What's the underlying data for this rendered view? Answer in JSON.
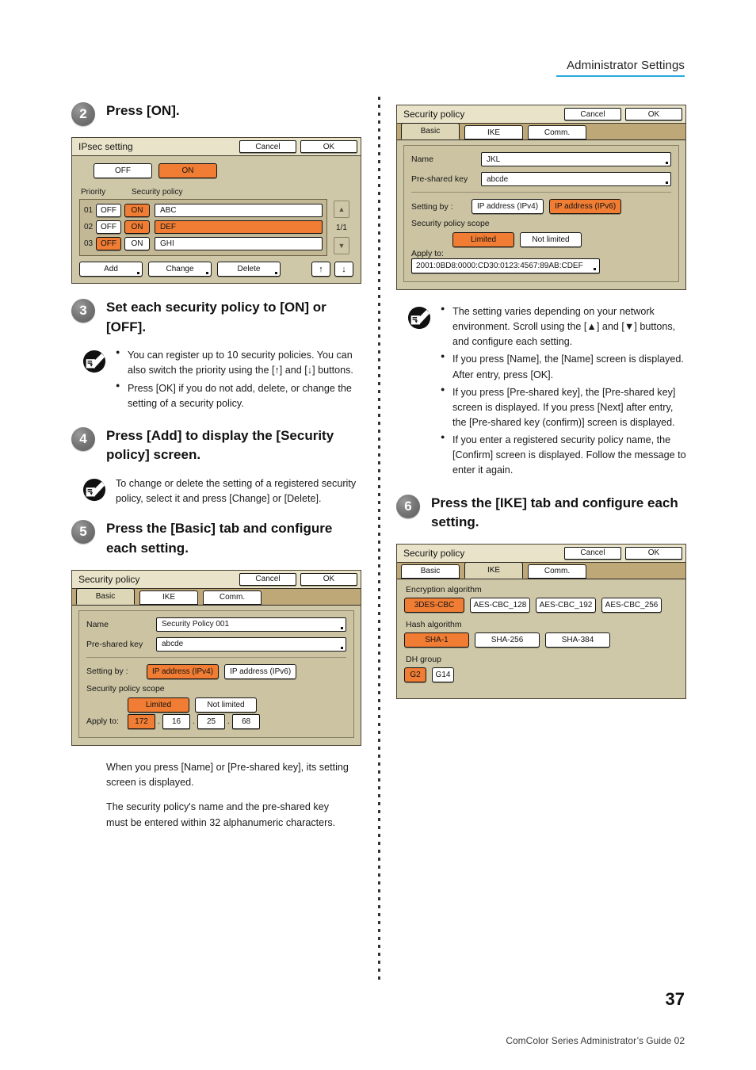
{
  "header": {
    "title": "Administrator Settings"
  },
  "footer": {
    "page_number": "37",
    "guide": "ComColor Series  Administrator’s Guide  02"
  },
  "left": {
    "step2": {
      "num": "2",
      "text": "Press [ON]."
    },
    "ipsec_screen": {
      "title": "IPsec setting",
      "cancel": "Cancel",
      "ok": "OK",
      "off": "OFF",
      "on": "ON",
      "col_priority": "Priority",
      "col_policy": "Security policy",
      "rows": [
        {
          "num": "01",
          "off": "OFF",
          "on": "ON",
          "name": "ABC"
        },
        {
          "num": "02",
          "off": "OFF",
          "on": "ON",
          "name": "DEF"
        },
        {
          "num": "03",
          "off": "OFF",
          "on": "ON",
          "name": "GHI"
        }
      ],
      "page_count": "1/1",
      "scroll_up": "▲",
      "scroll_down": "▼",
      "add": "Add",
      "change": "Change",
      "delete": "Delete",
      "move_up": "↑",
      "move_down": "↓"
    },
    "step3": {
      "num": "3",
      "text": "Set each security policy to [ON] or [OFF]."
    },
    "note3": {
      "items": [
        "You can register up to 10 security policies. You can also switch the priority using the [↑] and [↓] buttons.",
        "Press [OK] if you do not add, delete, or change the setting of a security policy."
      ]
    },
    "step4": {
      "num": "4",
      "text": "Press [Add] to display the [Security policy] screen."
    },
    "note4": {
      "text": "To change or delete the setting of a registered security policy, select it and press [Change] or [Delete]."
    },
    "step5": {
      "num": "5",
      "text": "Press the [Basic] tab and configure each setting."
    },
    "basic_screen": {
      "title": "Security policy",
      "cancel": "Cancel",
      "ok": "OK",
      "tabs": [
        {
          "label": "Basic",
          "active": true
        },
        {
          "label": "IKE",
          "active": false
        },
        {
          "label": "Comm.",
          "active": false
        }
      ],
      "name_label": "Name",
      "name_value": "Security Policy 001",
      "psk_label": "Pre-shared key",
      "psk_value": "abcde",
      "setting_by_label": "Setting by :",
      "ipv4": "IP address (IPv4)",
      "ipv6": "IP address (IPv6)",
      "scope_label": "Security policy scope",
      "limited": "Limited",
      "not_limited": "Not limited",
      "apply_to_label": "Apply to:",
      "octets": [
        "172",
        "16",
        "25",
        "68"
      ]
    },
    "para1": "When you press [Name] or [Pre-shared key], its setting screen is displayed.",
    "para2": "The security policy's name and the pre-shared key must be entered within 32 alphanumeric characters."
  },
  "right": {
    "basic_screen": {
      "title": "Security policy",
      "cancel": "Cancel",
      "ok": "OK",
      "tabs": [
        {
          "label": "Basic",
          "active": true
        },
        {
          "label": "IKE",
          "active": false
        },
        {
          "label": "Comm.",
          "active": false
        }
      ],
      "name_label": "Name",
      "name_value": "JKL",
      "psk_label": "Pre-shared key",
      "psk_value": "abcde",
      "setting_by_label": "Setting by :",
      "ipv4": "IP address (IPv4)",
      "ipv6": "IP address (IPv6)",
      "scope_label": "Security policy scope",
      "limited": "Limited",
      "not_limited": "Not limited",
      "apply_to_label": "Apply to:",
      "ipv6_value": "2001:0BD8:0000:CD30:0123:4567:89AB:CDEF"
    },
    "note5": {
      "items": [
        "The setting varies depending on your network environment. Scroll using the [▲] and [▼] buttons, and configure each setting.",
        "If you press [Name], the [Name] screen is displayed. After entry, press [OK].",
        "If you press [Pre-shared key], the [Pre-shared key] screen is displayed. If you press [Next] after entry, the [Pre-shared key (confirm)] screen is displayed.",
        "If you enter a registered security policy name, the [Confirm] screen is displayed. Follow the message to enter it again."
      ]
    },
    "step6": {
      "num": "6",
      "text": "Press the [IKE] tab and configure each setting."
    },
    "ike_screen": {
      "title": "Security policy",
      "cancel": "Cancel",
      "ok": "OK",
      "tabs": [
        {
          "label": "Basic",
          "active": false
        },
        {
          "label": "IKE",
          "active": true
        },
        {
          "label": "Comm.",
          "active": false
        }
      ],
      "enc_label": "Encryption algorithm",
      "enc_options": [
        "3DES-CBC",
        "AES-CBC_128",
        "AES-CBC_192",
        "AES-CBC_256"
      ],
      "hash_label": "Hash algorithm",
      "hash_options": [
        "SHA-1",
        "SHA-256",
        "SHA-384"
      ],
      "dh_label": "DH group",
      "dh_options": [
        "G2",
        "G14"
      ]
    }
  },
  "colors": {
    "accent_orange": "#F07D33",
    "panel_tan": "#CFC8A8",
    "tab_tan": "#BFA878",
    "header_rule": "#2AA8E0"
  }
}
